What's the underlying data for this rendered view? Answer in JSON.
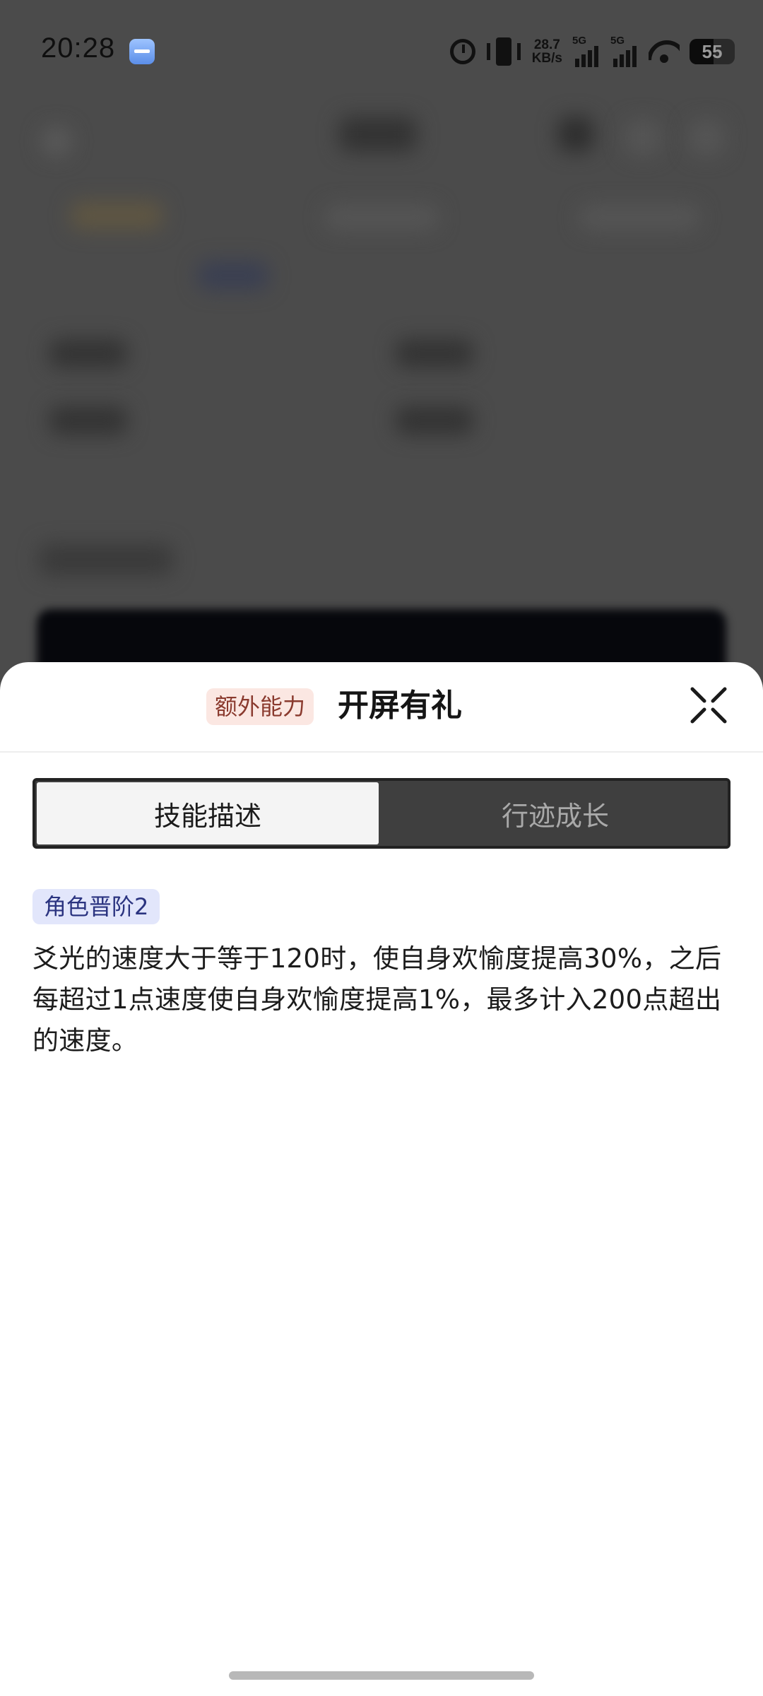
{
  "status_bar": {
    "time": "20:28",
    "net_speed_value": "28.7",
    "net_speed_unit": "KB/s",
    "sim1_label": "5G",
    "sim2_label": "5G",
    "battery_level": "55"
  },
  "sheet": {
    "tag": "额外能力",
    "title": "开屏有礼",
    "tabs": [
      {
        "label": "技能描述",
        "active": true
      },
      {
        "label": "行迹成长",
        "active": false
      }
    ],
    "level_badge": "角色晋阶2",
    "description": "爻光的速度大于等于120时，使自身欢愉度提高30%，之后每超过1点速度使自身欢愉度提高1%，最多计入200点超出的速度。"
  },
  "colors": {
    "tag_bg": "#fbe7e2",
    "tag_text": "#8a3a2e",
    "badge_bg": "#e2e6fb",
    "badge_text": "#2b3480",
    "tab_bar_bg": "#3f3f3f",
    "overlay_bg": "#4b4b4b"
  }
}
